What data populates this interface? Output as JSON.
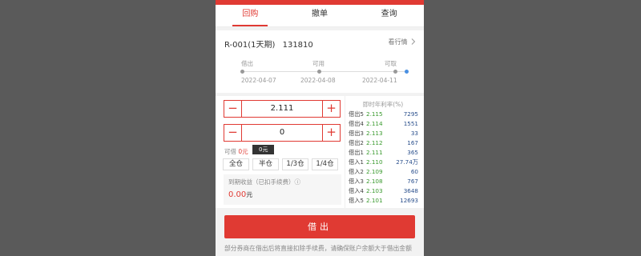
{
  "tabs": [
    {
      "label": "回购"
    },
    {
      "label": "撤单"
    },
    {
      "label": "查询"
    }
  ],
  "product": {
    "name": "R-001(1天期)",
    "code": "131810",
    "view_link": "看行情"
  },
  "timeline": {
    "labels": [
      "借出",
      "可用",
      "可取"
    ],
    "dates": [
      "2022-04-07",
      "2022-04-08",
      "2022-04-11"
    ]
  },
  "form": {
    "rate_value": "2.111",
    "amount_value": "0",
    "minus_glyph": "−",
    "plus_glyph": "+",
    "available_label": "可借",
    "available_value": "0元",
    "tooltip": "0元",
    "position_buttons": [
      "全仓",
      "半仓",
      "1/3仓",
      "1/4仓"
    ],
    "income_label": "到期收益（已扣手续费）ⓘ",
    "income_value": "0.00",
    "income_unit": "元"
  },
  "rates": {
    "header": "即时年利率(%)",
    "rows": [
      {
        "name": "借出5",
        "rate": "2.115",
        "vol": "7295"
      },
      {
        "name": "借出4",
        "rate": "2.114",
        "vol": "1551"
      },
      {
        "name": "借出3",
        "rate": "2.113",
        "vol": "33"
      },
      {
        "name": "借出2",
        "rate": "2.112",
        "vol": "167"
      },
      {
        "name": "借出1",
        "rate": "2.111",
        "vol": "365"
      },
      {
        "name": "借入1",
        "rate": "2.110",
        "vol": "27.74万"
      },
      {
        "name": "借入2",
        "rate": "2.109",
        "vol": "60"
      },
      {
        "name": "借入3",
        "rate": "2.108",
        "vol": "767"
      },
      {
        "name": "借入4",
        "rate": "2.103",
        "vol": "3648"
      },
      {
        "name": "借入5",
        "rate": "2.101",
        "vol": "12693"
      }
    ]
  },
  "action": {
    "borrow_label": "借出"
  },
  "note": "部分券商在借出后将直接扣除手续费，请确保账户余额大于借出金额",
  "colors": {
    "accent": "#e03a33",
    "rate_green": "#3a9a2e",
    "volume_blue": "#2a4f8c"
  }
}
